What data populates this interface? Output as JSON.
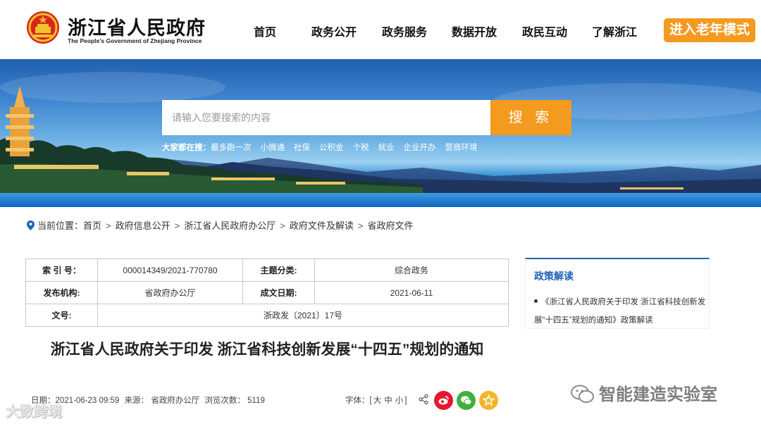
{
  "header": {
    "site_name": "浙江省人民政府",
    "site_name_en": "The People's Government of Zhejiang Province",
    "nav": [
      "首页",
      "政务公开",
      "政务服务",
      "数据开放",
      "政民互动",
      "了解浙江"
    ],
    "elder_mode": "进入老年模式",
    "accent": "#f39a1f"
  },
  "search": {
    "placeholder": "请输入您要搜索的内容",
    "button": "搜 索",
    "hot_label": "大家都在搜：",
    "hot_items": [
      "最多跑一次",
      "小微通",
      "社保",
      "公积金",
      "个税",
      "就业",
      "企业开办",
      "营商环境"
    ]
  },
  "breadcrumb": {
    "label": "当前位置：",
    "items": [
      "首页",
      "政府信息公开",
      "浙江省人民政府办公厅",
      "政府文件及解读",
      "省政府文件"
    ]
  },
  "info": {
    "index_label": "索 引 号：",
    "index_value": "000014349/2021-770780",
    "category_label": "主题分类:",
    "category_value": "综合政务",
    "issuer_label": "发布机构:",
    "issuer_value": "省政府办公厅",
    "date_label": "成文日期:",
    "date_value": "2021-06-11",
    "docno_label": "文号:",
    "docno_value": "浙政发〔2021〕17号"
  },
  "document": {
    "title": "浙江省人民政府关于印发 浙江省科技创新发展“十四五”规划的通知"
  },
  "meta": {
    "date": "日期：2021-06-23 09:59",
    "source": "来源： 省政府办公厅",
    "views": "浏览次数： 5119",
    "font_label": "字体：[",
    "font_large": "大",
    "font_medium": "中",
    "font_small": "小",
    "font_end": "]"
  },
  "sidebar": {
    "title": "政策解读",
    "link": "《浙江省人民政府关于印发 浙江省科技创新发展“十四五”规划的通知》政策解读",
    "accent": "#1f62b3"
  },
  "watermarks": {
    "right": "智能建造实验室",
    "left": "大数跨境"
  }
}
